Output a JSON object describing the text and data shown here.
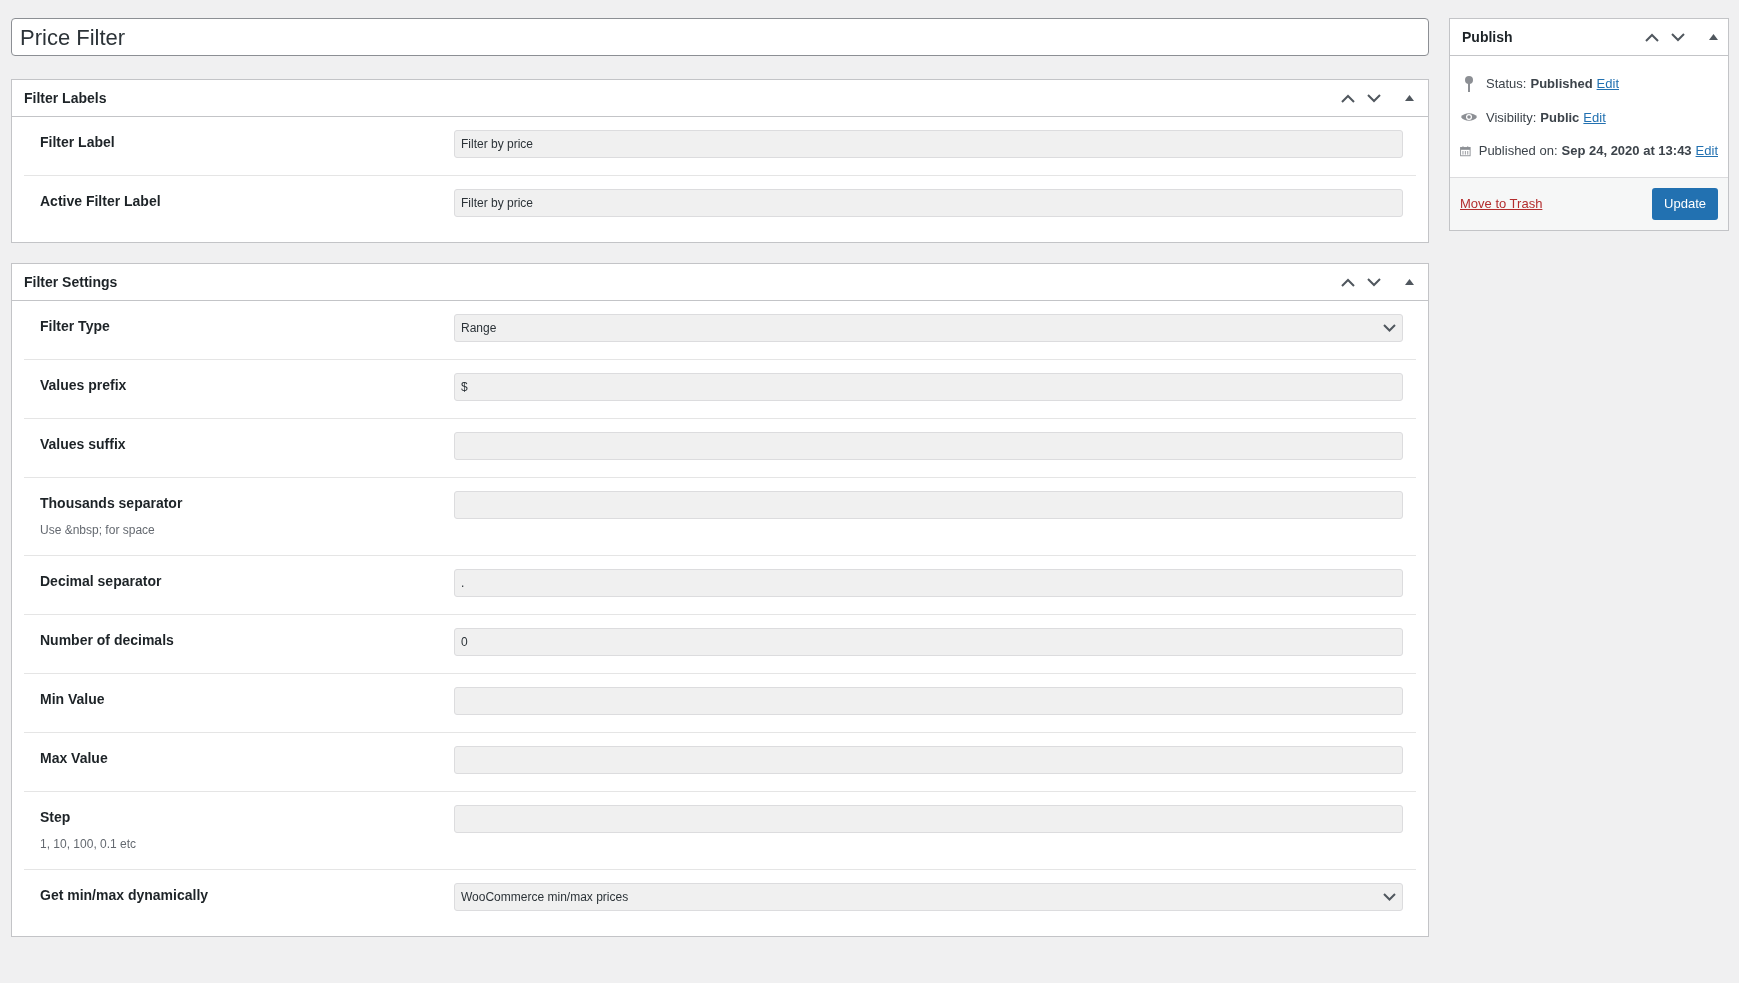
{
  "title_field": {
    "value": "Price Filter"
  },
  "panels": [
    {
      "title": "Filter Labels",
      "rows": [
        {
          "label": "Filter Label",
          "kind": "text",
          "value": "Filter by price"
        },
        {
          "label": "Active Filter Label",
          "kind": "text",
          "value": "Filter by price"
        }
      ]
    },
    {
      "title": "Filter Settings",
      "rows": [
        {
          "label": "Filter Type",
          "kind": "select",
          "value": "Range"
        },
        {
          "label": "Values prefix",
          "kind": "text",
          "value": "$"
        },
        {
          "label": "Values suffix",
          "kind": "text"
        },
        {
          "label": "Thousands separator",
          "kind": "text",
          "hint": "Use &nbsp; for space"
        },
        {
          "label": "Decimal separator",
          "kind": "text",
          "value": "."
        },
        {
          "label": "Number of decimals",
          "kind": "text",
          "value": "0"
        },
        {
          "label": "Min Value",
          "kind": "text"
        },
        {
          "label": "Max Value",
          "kind": "text"
        },
        {
          "label": "Step",
          "kind": "text",
          "hint": "1, 10, 100, 0.1 etc"
        },
        {
          "label": "Get min/max dynamically",
          "kind": "select",
          "value": "WooCommerce min/max prices"
        }
      ]
    }
  ],
  "publish": {
    "title": "Publish",
    "items": [
      {
        "kind": "status",
        "label": "Status:",
        "value": "Published",
        "link": "Edit"
      },
      {
        "kind": "visibility",
        "label": "Visibility:",
        "value": "Public",
        "link": "Edit"
      },
      {
        "kind": "date",
        "label": "Published on:",
        "value": "Sep 24, 2020 at 13:43",
        "link": "Edit"
      }
    ],
    "trash": "Move to Trash",
    "button": "Update"
  }
}
